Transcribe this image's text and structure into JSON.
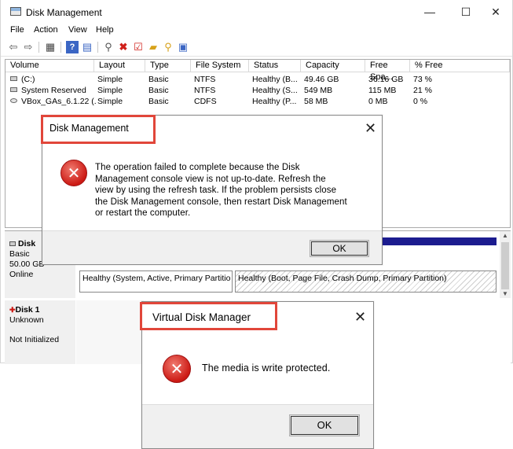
{
  "window": {
    "title": "Disk Management",
    "minimize_glyph": "—",
    "maximize_glyph": "☐",
    "close_glyph": "✕"
  },
  "menu": [
    "File",
    "Action",
    "View",
    "Help"
  ],
  "toolbar_icons": [
    "back-icon",
    "forward-icon",
    "console-tree-icon",
    "help-icon",
    "properties-icon",
    "connect-icon",
    "delete-icon",
    "check-icon",
    "folder-icon",
    "search-icon",
    "settings-icon"
  ],
  "volumes": {
    "columns": [
      "Volume",
      "Layout",
      "Type",
      "File System",
      "Status",
      "Capacity",
      "Free Spa...",
      "% Free"
    ],
    "rows": [
      [
        "(C:)",
        "Simple",
        "Basic",
        "NTFS",
        "Healthy (B...",
        "49.46 GB",
        "36.16 GB",
        "73 %"
      ],
      [
        "System Reserved",
        "Simple",
        "Basic",
        "NTFS",
        "Healthy (S...",
        "549 MB",
        "115 MB",
        "21 %"
      ],
      [
        "VBox_GAs_6.1.22 (...",
        "Simple",
        "Basic",
        "CDFS",
        "Healthy (P...",
        "58 MB",
        "0 MB",
        "0 %"
      ]
    ]
  },
  "disks": {
    "disk0": {
      "name": "Disk",
      "type": "Basic",
      "size": "50.00 GB",
      "state": "Online",
      "part1": "Healthy (System, Active, Primary Partitio",
      "part2": "Healthy (Boot, Page File, Crash Dump, Primary Partition)"
    },
    "disk1": {
      "name": "Disk 1",
      "state": "Unknown",
      "status": "Not Initialized"
    }
  },
  "dialog1": {
    "title": "Disk Management",
    "message": [
      "The operation failed to complete because the Disk",
      "Management console view is not up-to-date.  Refresh the",
      "view by using the refresh task. If the problem persists close",
      "the Disk Management console, then restart Disk Management",
      "or restart the computer."
    ],
    "ok": "OK",
    "close": "✕",
    "icon_glyph": "✕"
  },
  "dialog2": {
    "title": "Virtual Disk Manager",
    "message": "The media is write protected.",
    "ok": "OK",
    "close": "✕",
    "icon_glyph": "✕"
  },
  "colors": {
    "highlight": "#e1463a",
    "error": "#cc1a14",
    "partition_stripe": "#1c1c8f"
  }
}
